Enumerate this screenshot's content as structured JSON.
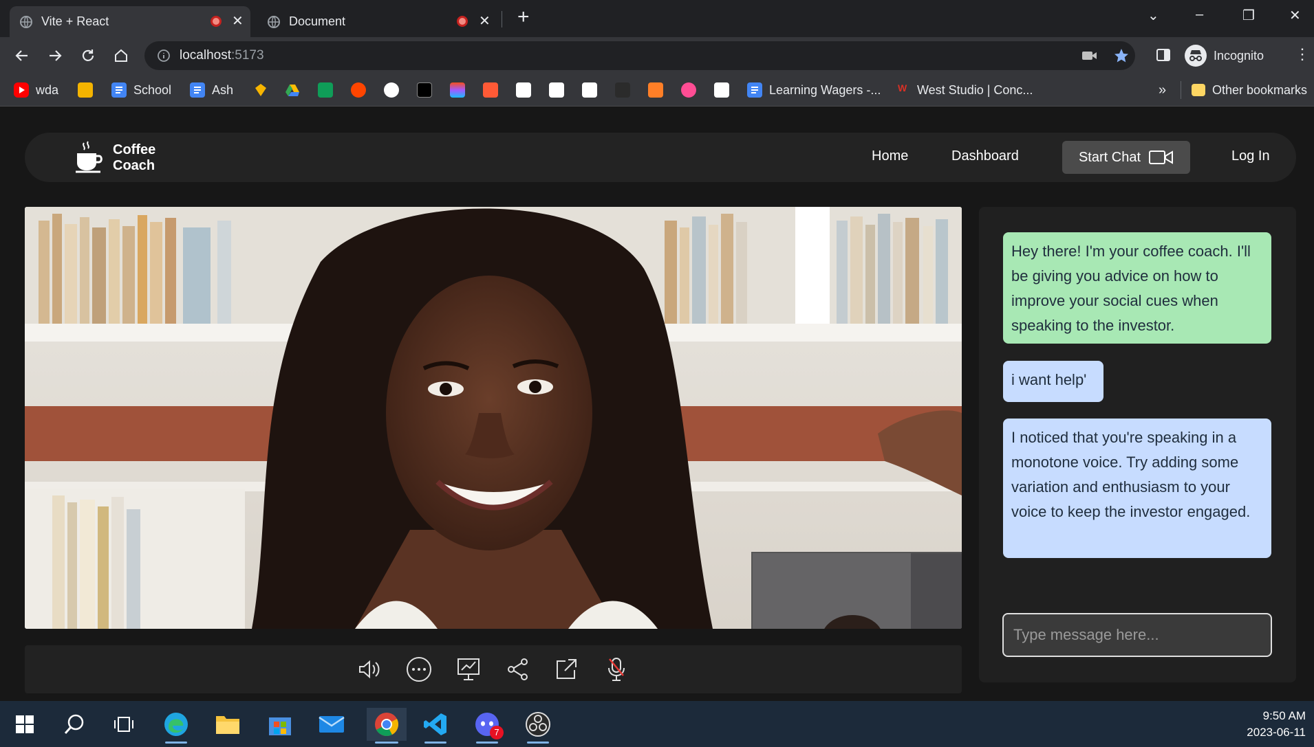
{
  "browser": {
    "tabs": [
      {
        "title": "Vite + React",
        "active": true
      },
      {
        "title": "Document",
        "active": false
      }
    ],
    "url_host": "localhost",
    "url_port": ":5173",
    "profile_label": "Incognito",
    "bookmarks": [
      {
        "label": "wda",
        "icon": "youtube-icon",
        "color": "#ff0000"
      },
      {
        "label": "",
        "icon": "classroom-icon",
        "color": "#f4b400"
      },
      {
        "label": "School",
        "icon": "docs-icon",
        "color": "#4285f4"
      },
      {
        "label": "Ash",
        "icon": "docs-icon",
        "color": "#4285f4"
      },
      {
        "label": "",
        "icon": "sketch-icon",
        "color": "#f7b500"
      },
      {
        "label": "",
        "icon": "drive-icon",
        "color": "#34a853"
      },
      {
        "label": "",
        "icon": "sheets-icon",
        "color": "#0f9d58"
      },
      {
        "label": "",
        "icon": "reddit-icon",
        "color": "#ff4500"
      },
      {
        "label": "",
        "icon": "github-icon",
        "color": "#ffffff"
      },
      {
        "label": "",
        "icon": "replit-icon",
        "color": "#000000"
      },
      {
        "label": "",
        "icon": "figma-icon",
        "color": "#a259ff"
      },
      {
        "label": "",
        "icon": "99d-icon",
        "color": "#ff5a36"
      },
      {
        "label": "",
        "icon": "page-icon",
        "color": "#ffffff"
      },
      {
        "label": "",
        "icon": "page-icon",
        "color": "#ffffff"
      },
      {
        "label": "",
        "icon": "page-icon",
        "color": "#ffffff"
      },
      {
        "label": "",
        "icon": "medium-icon",
        "color": "#2b2b2b"
      },
      {
        "label": "",
        "icon": "cb-icon",
        "color": "#ff7f27"
      },
      {
        "label": "",
        "icon": "star-app-icon",
        "color": "#ff4d94"
      },
      {
        "label": "",
        "icon": "z-app-icon",
        "color": "#ffffff"
      },
      {
        "label": "Learning Wagers -...",
        "icon": "docs-icon",
        "color": "#4285f4"
      },
      {
        "label": "West Studio | Conc...",
        "icon": "ws-icon",
        "color": "#d93025"
      }
    ],
    "bookmarks_overflow": "»",
    "other_bookmarks": "Other bookmarks"
  },
  "app": {
    "brand_line1": "Coffee",
    "brand_line2": "Coach",
    "nav": {
      "home": "Home",
      "dashboard": "Dashboard",
      "start_chat": "Start Chat",
      "login": "Log In"
    },
    "chat": {
      "messages": [
        {
          "sender": "coach",
          "text": "Hey there! I'm your coffee coach. I'll be giving you advice on how to improve your social cues when speaking to the investor."
        },
        {
          "sender": "user",
          "text": "i want help'"
        },
        {
          "sender": "coach",
          "text": "I noticed that you're speaking in a monotone voice. Try adding some variation and enthusiasm to your voice to keep the investor engaged."
        }
      ],
      "input_placeholder": "Type message here..."
    },
    "controls": [
      "speaker-icon",
      "more-icon",
      "present-icon",
      "share-icon",
      "open-external-icon",
      "mic-muted-icon"
    ]
  },
  "taskbar": {
    "apps": [
      "search-icon",
      "task-view-icon",
      "edge-icon",
      "file-explorer-icon",
      "store-icon",
      "mail-icon",
      "chrome-icon",
      "vscode-icon",
      "discord-icon",
      "obs-icon"
    ],
    "discord_badge": "7",
    "time": "9:50 AM",
    "date": "2023-06-11"
  }
}
